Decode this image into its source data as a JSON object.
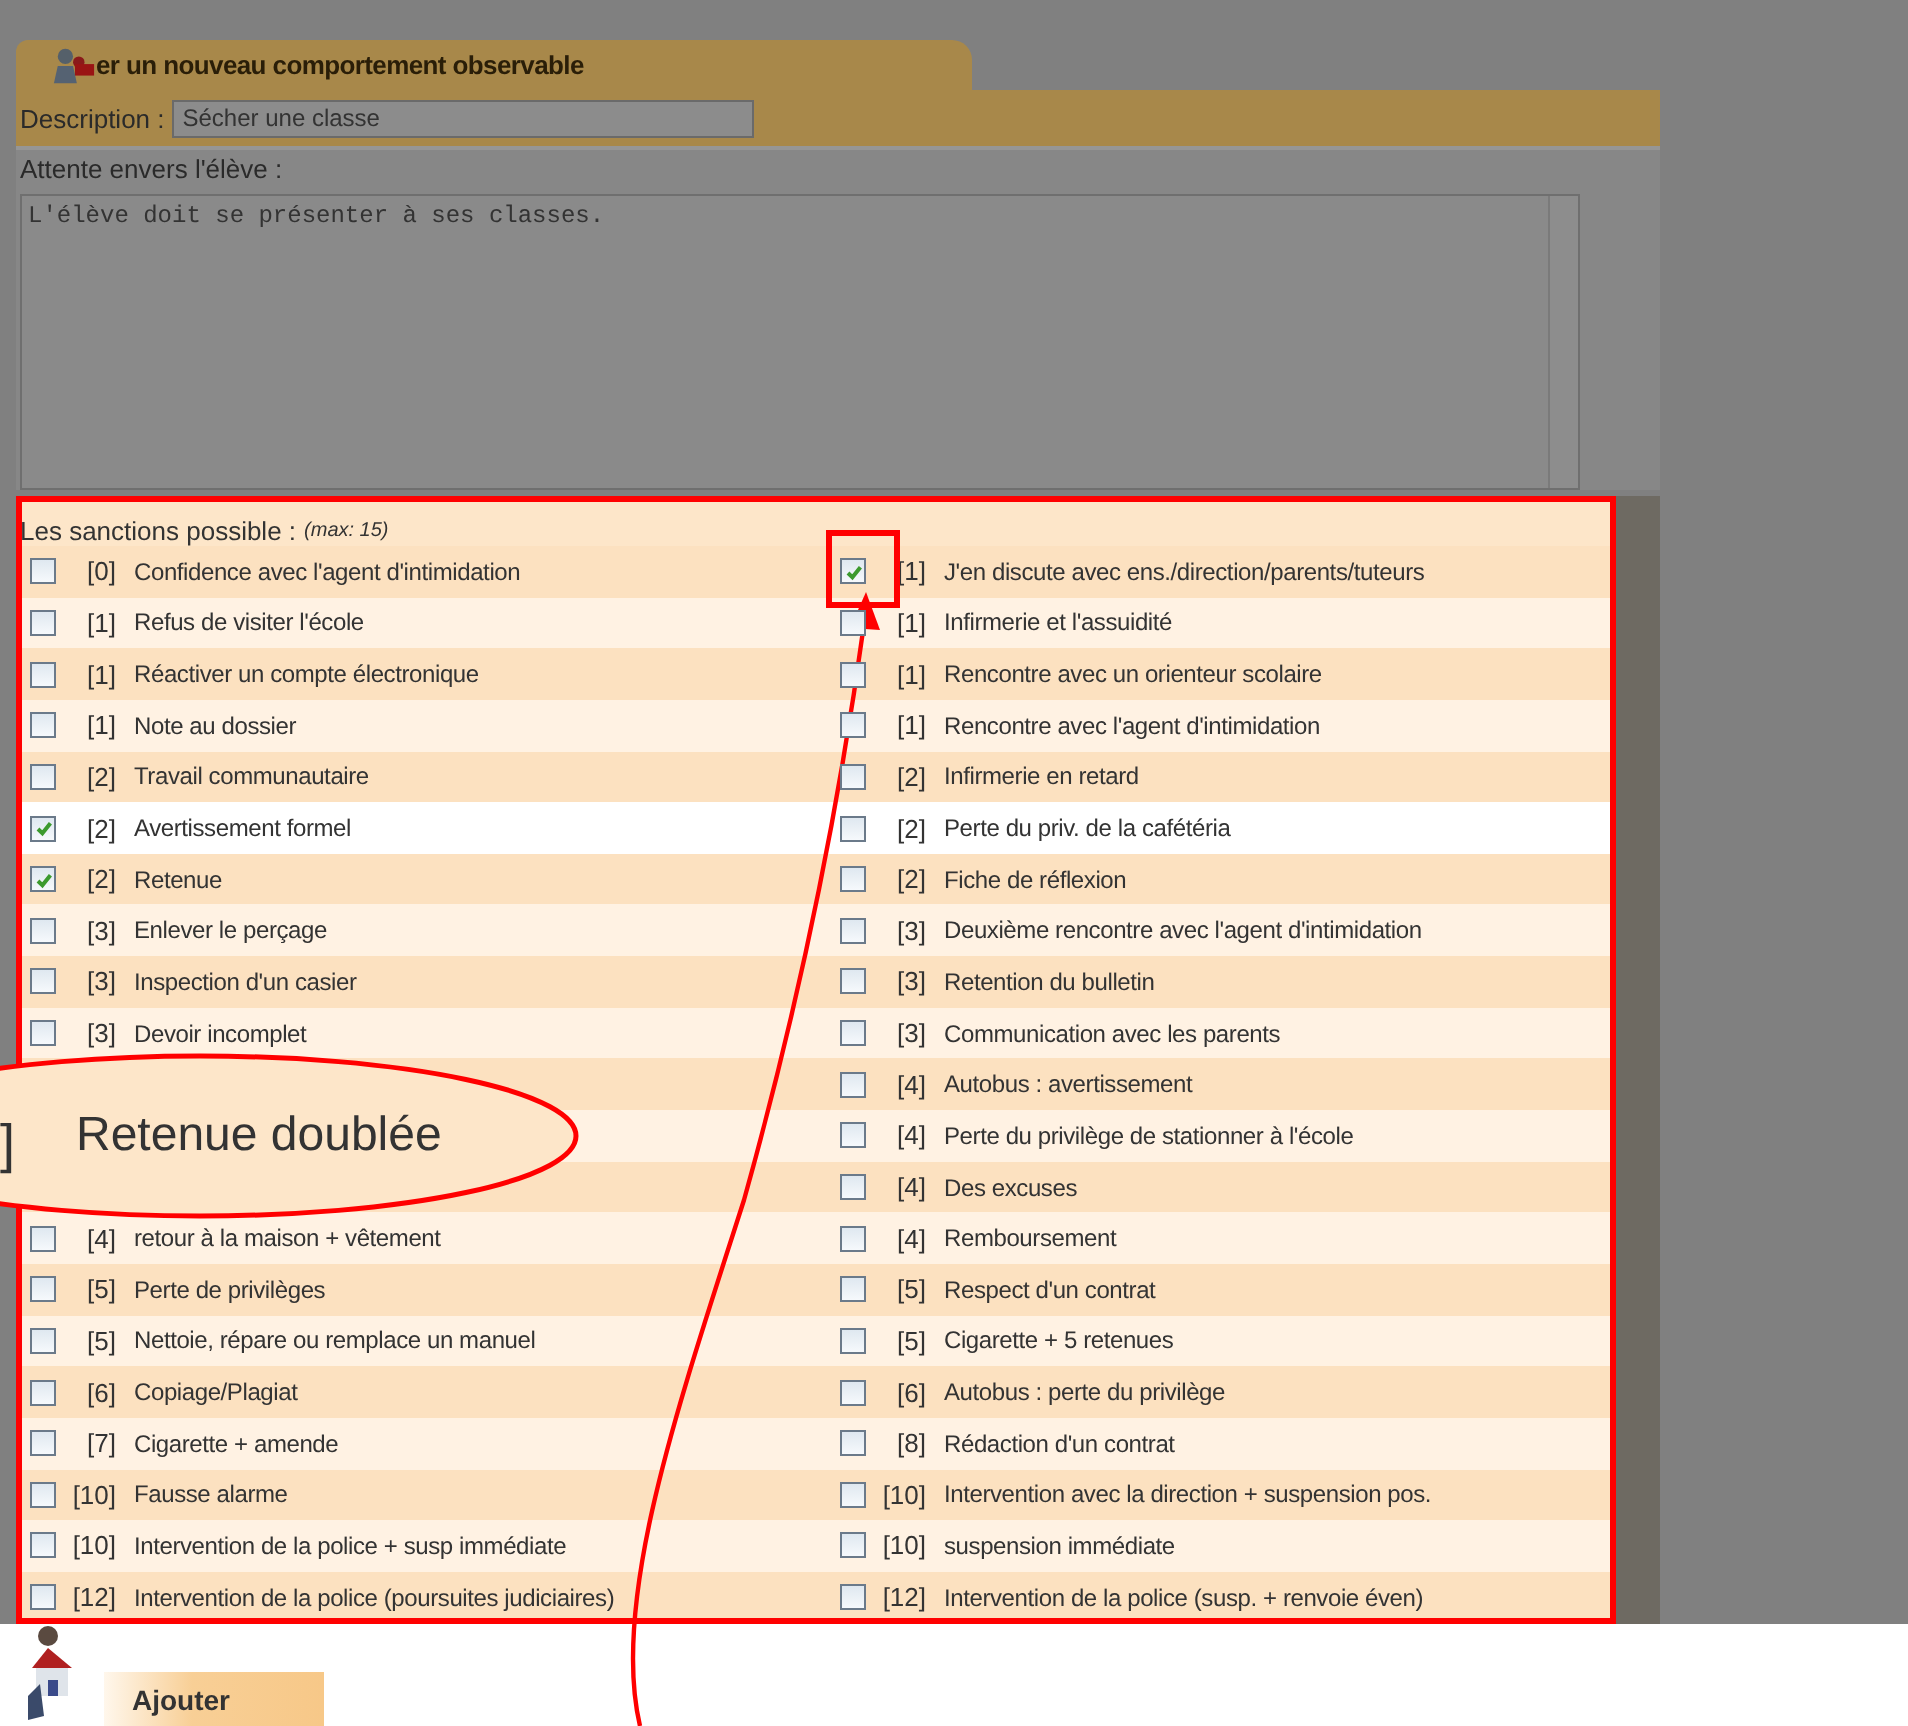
{
  "form": {
    "tab_title": "er un nouveau comportement observable",
    "description_label": "Description :",
    "description_value": "Sécher une classe",
    "expectation_label": "Attente envers l'élève :",
    "expectation_value": "L'élève doit se présenter à ses classes."
  },
  "sanctions": {
    "title": "Les sanctions possible :",
    "note": "(max: 15)",
    "rows": [
      {
        "highlighted": false,
        "left": {
          "points": "[0]",
          "label": "Confidence avec l'agent d'intimidation",
          "checked": false
        },
        "right": {
          "points": "[1]",
          "label": "J'en discute avec ens./direction/parents/tuteurs",
          "checked": true
        }
      },
      {
        "highlighted": false,
        "left": {
          "points": "[1]",
          "label": "Refus de visiter l'école",
          "checked": false
        },
        "right": {
          "points": "[1]",
          "label": "Infirmerie et l'assuidité",
          "checked": false
        }
      },
      {
        "highlighted": false,
        "left": {
          "points": "[1]",
          "label": "Réactiver un compte électronique",
          "checked": false
        },
        "right": {
          "points": "[1]",
          "label": "Rencontre avec un orienteur scolaire",
          "checked": false
        }
      },
      {
        "highlighted": false,
        "left": {
          "points": "[1]",
          "label": "Note au dossier",
          "checked": false
        },
        "right": {
          "points": "[1]",
          "label": "Rencontre avec l'agent d'intimidation",
          "checked": false
        }
      },
      {
        "highlighted": false,
        "left": {
          "points": "[2]",
          "label": "Travail communautaire",
          "checked": false
        },
        "right": {
          "points": "[2]",
          "label": "Infirmerie en retard",
          "checked": false
        }
      },
      {
        "highlighted": true,
        "left": {
          "points": "[2]",
          "label": "Avertissement formel",
          "checked": true
        },
        "right": {
          "points": "[2]",
          "label": "Perte du priv. de la cafétéria",
          "checked": false
        }
      },
      {
        "highlighted": false,
        "left": {
          "points": "[2]",
          "label": "Retenue",
          "checked": true
        },
        "right": {
          "points": "[2]",
          "label": "Fiche de réflexion",
          "checked": false
        }
      },
      {
        "highlighted": false,
        "left": {
          "points": "[3]",
          "label": "Enlever le perçage",
          "checked": false
        },
        "right": {
          "points": "[3]",
          "label": "Deuxième rencontre avec l'agent d'intimidation",
          "checked": false
        }
      },
      {
        "highlighted": false,
        "left": {
          "points": "[3]",
          "label": "Inspection d'un casier",
          "checked": false
        },
        "right": {
          "points": "[3]",
          "label": "Retention du bulletin",
          "checked": false
        }
      },
      {
        "highlighted": false,
        "left": {
          "points": "[3]",
          "label": "Devoir incomplet",
          "checked": false
        },
        "right": {
          "points": "[3]",
          "label": "Communication avec les parents",
          "checked": false
        }
      },
      {
        "highlighted": false,
        "right": {
          "points": "[4]",
          "label": "Autobus : avertissement",
          "checked": false
        }
      },
      {
        "highlighted": false,
        "right": {
          "points": "[4]",
          "label": "Perte du privilège de stationner à l'école",
          "checked": false
        }
      },
      {
        "highlighted": false,
        "right": {
          "points": "[4]",
          "label": "Des excuses",
          "checked": false
        }
      },
      {
        "highlighted": false,
        "left": {
          "points": "[4]",
          "label": "retour à la maison + vêtement",
          "checked": false
        },
        "right": {
          "points": "[4]",
          "label": "Remboursement",
          "checked": false
        }
      },
      {
        "highlighted": false,
        "left": {
          "points": "[5]",
          "label": "Perte de privilèges",
          "checked": false
        },
        "right": {
          "points": "[5]",
          "label": "Respect d'un contrat",
          "checked": false
        }
      },
      {
        "highlighted": false,
        "left": {
          "points": "[5]",
          "label": "Nettoie, répare ou remplace un manuel",
          "checked": false
        },
        "right": {
          "points": "[5]",
          "label": "Cigarette + 5 retenues",
          "checked": false
        }
      },
      {
        "highlighted": false,
        "left": {
          "points": "[6]",
          "label": "Copiage/Plagiat",
          "checked": false
        },
        "right": {
          "points": "[6]",
          "label": "Autobus : perte du privilège",
          "checked": false
        }
      },
      {
        "highlighted": false,
        "left": {
          "points": "[7]",
          "label": "Cigarette + amende",
          "checked": false
        },
        "right": {
          "points": "[8]",
          "label": "Rédaction d'un contrat",
          "checked": false
        }
      },
      {
        "highlighted": false,
        "left": {
          "points": "[10]",
          "label": "Fausse alarme",
          "checked": false
        },
        "right": {
          "points": "[10]",
          "label": "Intervention avec la direction + suspension pos.",
          "checked": false
        }
      },
      {
        "highlighted": false,
        "left": {
          "points": "[10]",
          "label": "Intervention de la police + susp immédiate",
          "checked": false
        },
        "right": {
          "points": "[10]",
          "label": "suspension immédiate",
          "checked": false
        }
      },
      {
        "highlighted": false,
        "left": {
          "points": "[12]",
          "label": "Intervention de la police (poursuites judiciaires)",
          "checked": false
        },
        "right": {
          "points": "[12]",
          "label": "Intervention de la police (susp. + renvoie éven)",
          "checked": false
        }
      }
    ]
  },
  "add_button": {
    "label": "Ajouter"
  },
  "callout": {
    "points": "]",
    "label": "Retenue doublée"
  }
}
